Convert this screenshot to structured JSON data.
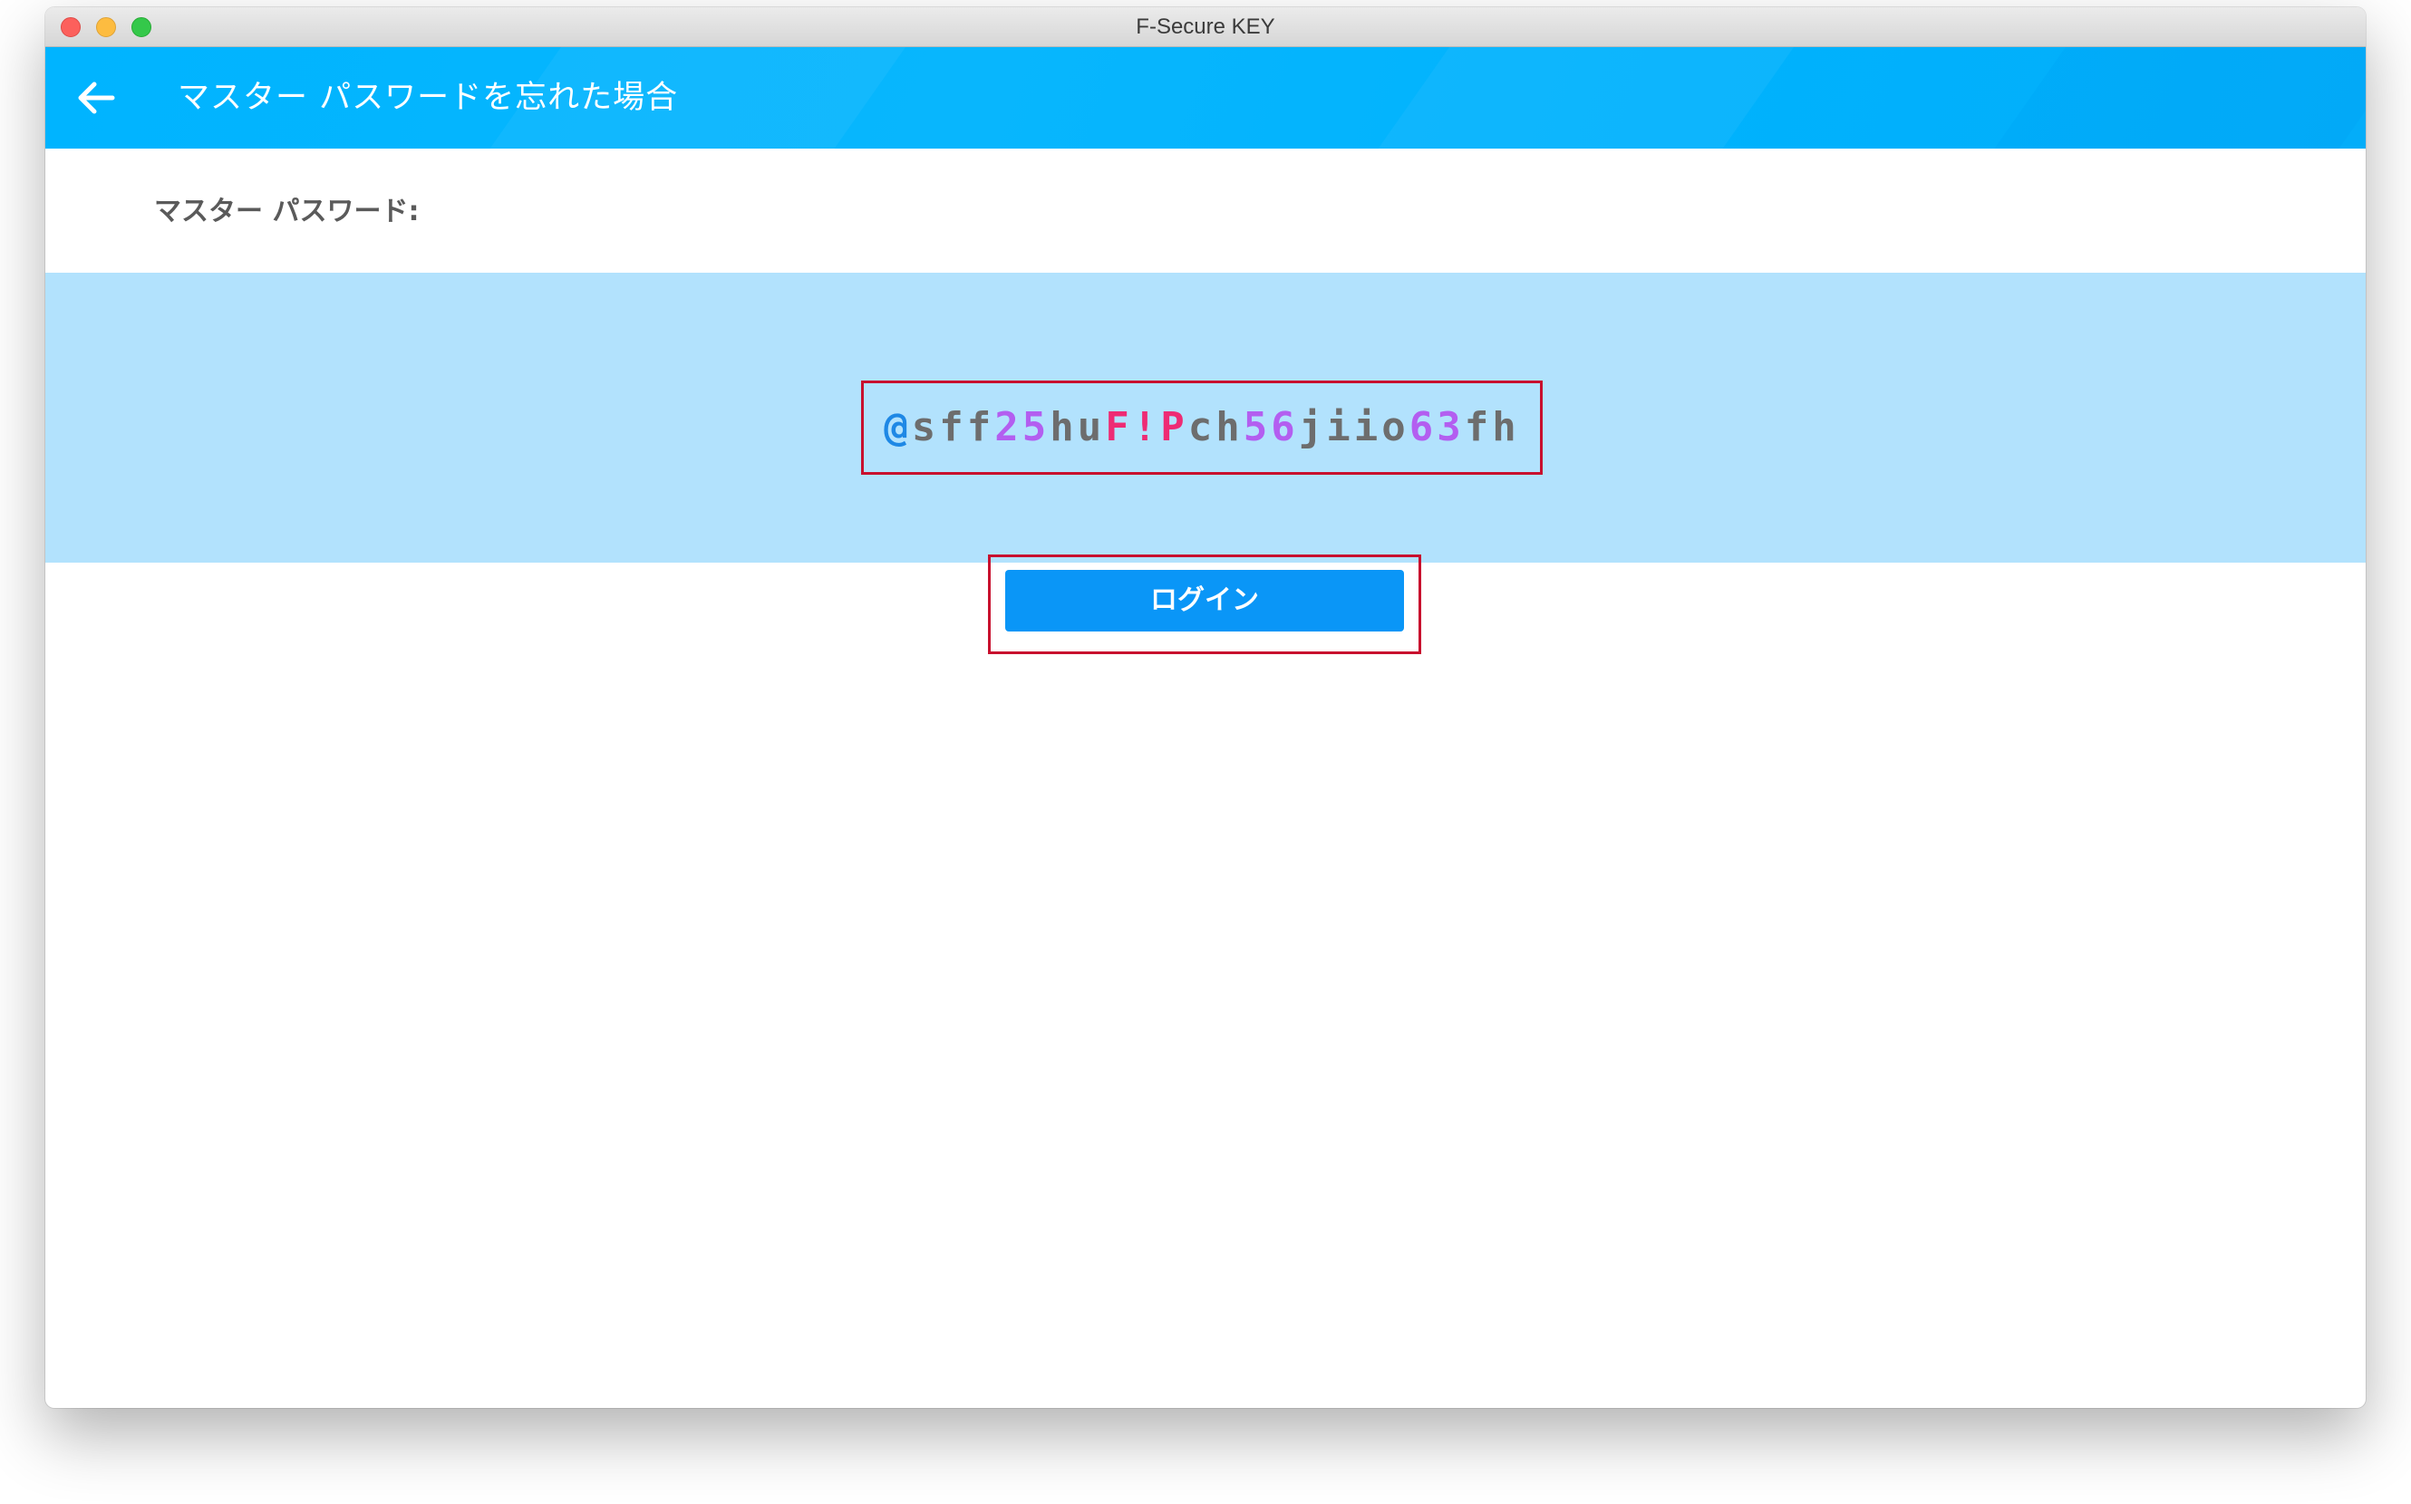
{
  "window": {
    "title": "F-Secure KEY"
  },
  "header": {
    "title": "マスター パスワードを忘れた場合",
    "back_icon": "arrow-left-icon"
  },
  "main": {
    "label": "マスター パスワード:",
    "password": "@sff25huF!Pch56jiio63fh",
    "login_label": "ログイン"
  },
  "colors": {
    "accent": "#00B4FF",
    "band": "#B2E2FD",
    "button": "#0A96F7",
    "highlight_border": "#C8102E",
    "pw_gray": "#6D6D6D",
    "pw_blue": "#1E88E5",
    "pw_purple": "#B35EF0",
    "pw_pink": "#EE2B74"
  }
}
